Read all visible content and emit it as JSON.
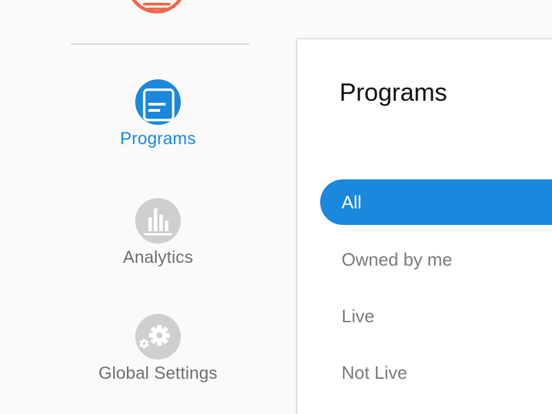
{
  "colors": {
    "accent": "#1a88dd",
    "logo": "#f2674a",
    "inactive_icon": "#cfcfcf",
    "inactive_text": "#6e6e6e",
    "filter_text": "#7a7a7a"
  },
  "sidebar": {
    "logo_icon": "logo-icon",
    "items": [
      {
        "label": "Programs",
        "icon": "programs-icon",
        "active": true
      },
      {
        "label": "Analytics",
        "icon": "bar-chart-icon",
        "active": false
      },
      {
        "label": "Global Settings",
        "icon": "gear-icon",
        "active": false
      }
    ]
  },
  "panel": {
    "title": "Programs",
    "filters": [
      {
        "label": "All",
        "active": true
      },
      {
        "label": "Owned by me",
        "active": false
      },
      {
        "label": "Live",
        "active": false
      },
      {
        "label": "Not Live",
        "active": false
      }
    ]
  }
}
